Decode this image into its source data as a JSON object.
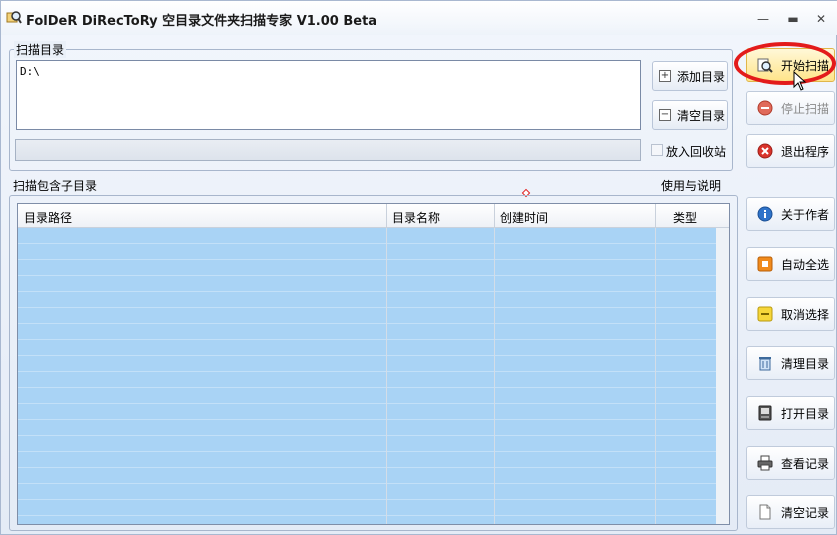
{
  "window": {
    "title": "FolDeR DiRecToRy 空目录文件夹扫描专家 V1.00 Beta",
    "minimize_symbol": "▬",
    "close_symbol": "✕",
    "extra_symbol": "—"
  },
  "scan_dir": {
    "group_label": "扫描目录",
    "paths": "D:\\",
    "add_button": "添加目录",
    "clear_button": "清空目录",
    "search_value": "",
    "recycle_checkbox_label": "放入回收站",
    "recycle_checked": false
  },
  "results": {
    "group_label": "扫描包含子目录",
    "help_link": "使用与说明",
    "columns": [
      "目录路径",
      "目录名称",
      "创建时间",
      "类型"
    ],
    "rows": []
  },
  "sidebar": {
    "start_scan": "开始扫描",
    "stop_scan": "停止扫描",
    "exit": "退出程序",
    "about": "关于作者",
    "select_all": "自动全选",
    "deselect": "取消选择",
    "clean_dir": "清理目录",
    "open_dir": "打开目录",
    "view_log": "查看记录",
    "clear_log": "清空记录"
  },
  "colors": {
    "highlight_ellipse": "#e31b1b",
    "row_fill": "#a9d3f5",
    "active_button": "#ffe48a"
  }
}
